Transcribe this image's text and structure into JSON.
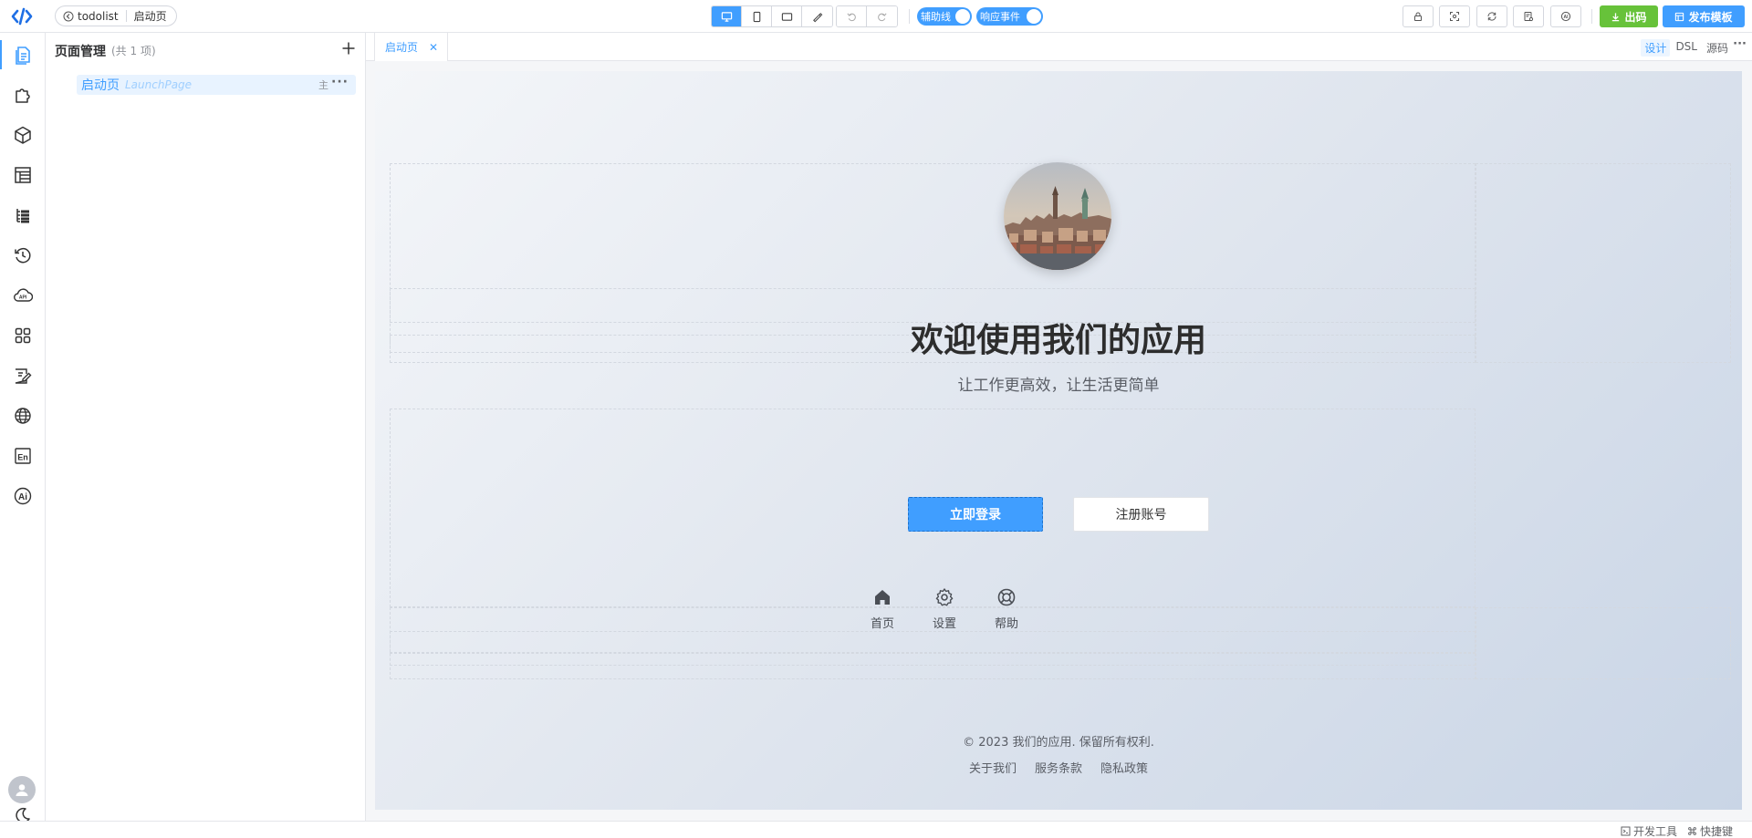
{
  "app": {
    "project_name": "todolist",
    "current_page": "启动页"
  },
  "toolbar": {
    "guide_toggle_label": "辅助线",
    "event_toggle_label": "响应事件",
    "export_label": "出码",
    "publish_label": "发布模板"
  },
  "panel": {
    "title": "页面管理",
    "count": "(共 1 项)",
    "pages": [
      {
        "name": "启动页",
        "key": "LaunchPage",
        "main_badge": "主"
      }
    ]
  },
  "editor": {
    "tab_label": "启动页",
    "mode_tabs": [
      "设计",
      "DSL",
      "源码"
    ],
    "active_mode": "设计"
  },
  "preview": {
    "title": "欢迎使用我们的应用",
    "subtitle": "让工作更高效，让生活更简单",
    "login_button": "立即登录",
    "register_button": "注册账号",
    "nav": [
      {
        "icon": "home-icon",
        "label": "首页"
      },
      {
        "icon": "gear-icon",
        "label": "设置"
      },
      {
        "icon": "help-icon",
        "label": "帮助"
      }
    ],
    "copyright": "© 2023 我们的应用. 保留所有权利.",
    "footer_links": [
      "关于我们",
      "服务条款",
      "隐私政策"
    ]
  },
  "statusbar": {
    "devtools": "开发工具",
    "shortcuts": "快捷键"
  },
  "colors": {
    "accent": "#409eff",
    "success": "#67c23a"
  }
}
